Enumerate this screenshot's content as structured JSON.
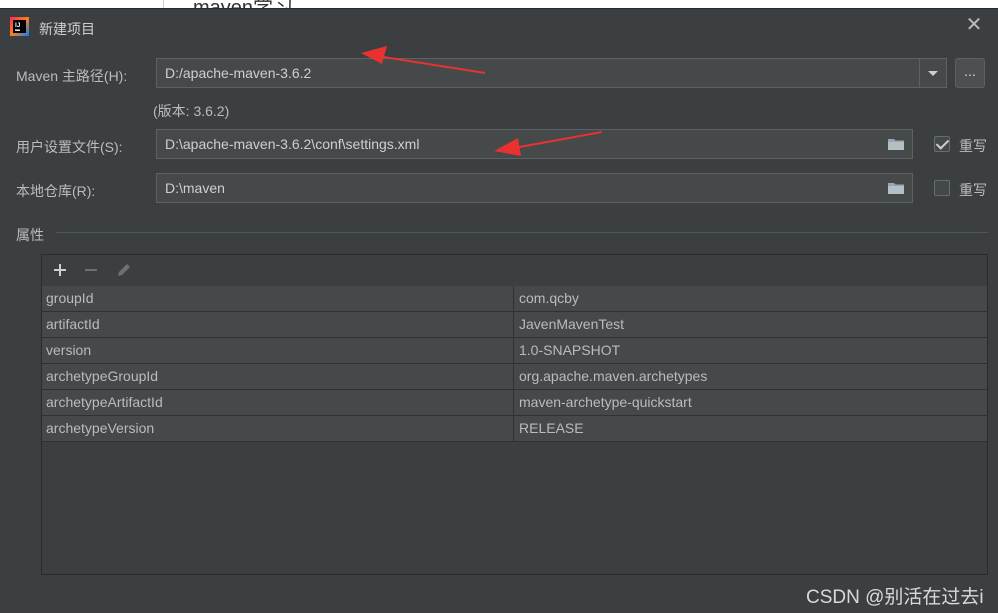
{
  "dialog": {
    "title": "新建项目"
  },
  "form": {
    "maven_home": {
      "label": "Maven 主路径(H):",
      "value": "D:/apache-maven-3.6.2",
      "version": "(版本: 3.6.2)"
    },
    "user_settings": {
      "label": "用户设置文件(S):",
      "value": "D:\\apache-maven-3.6.2\\conf\\settings.xml",
      "override_label": "重写",
      "override_checked": true
    },
    "local_repo": {
      "label": "本地仓库(R):",
      "value": "D:\\maven",
      "override_label": "重写",
      "override_checked": false
    },
    "browse_button": "..."
  },
  "properties": {
    "section_label": "属性",
    "rows": [
      {
        "key": "groupId",
        "value": "com.qcby"
      },
      {
        "key": "artifactId",
        "value": "JavenMavenTest"
      },
      {
        "key": "version",
        "value": "1.0-SNAPSHOT"
      },
      {
        "key": "archetypeGroupId",
        "value": "org.apache.maven.archetypes"
      },
      {
        "key": "archetypeArtifactId",
        "value": "maven-archetype-quickstart"
      },
      {
        "key": "archetypeVersion",
        "value": "RELEASE"
      }
    ]
  },
  "background": {
    "tab_text": "maven学习"
  },
  "watermark": "CSDN @别活在过去i",
  "colors": {
    "dialog_bg": "#3c3f41",
    "field_bg": "#45494a",
    "annotation_arrow": "#e8322f"
  }
}
